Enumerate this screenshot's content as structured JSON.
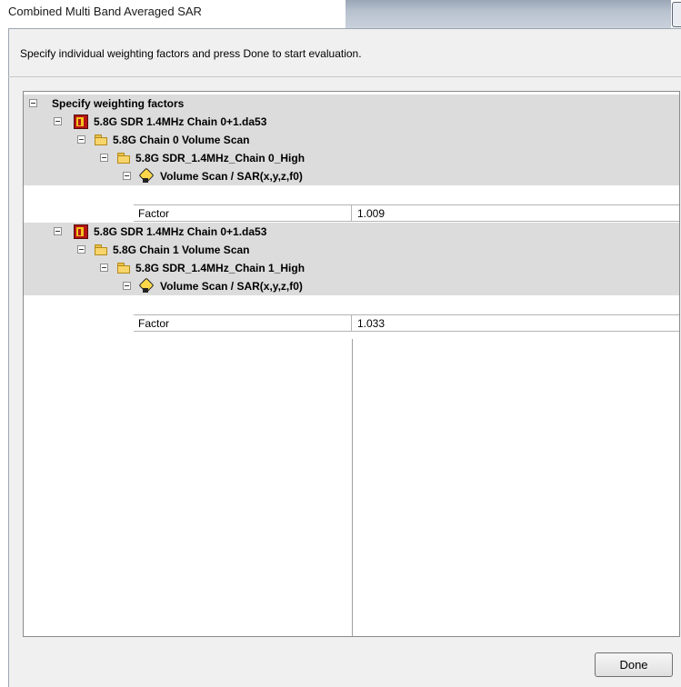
{
  "window": {
    "title": "Combined Multi Band Averaged SAR"
  },
  "instruction": "Specify individual weighting factors and press Done to start evaluation.",
  "tree": {
    "root_label": "Specify weighting factors",
    "files": [
      {
        "label": "5.8G SDR 1.4MHz Chain 0+1.da53",
        "folder": "5.8G Chain 0 Volume Scan",
        "subfolder": "5.8G SDR_1.4MHz_Chain 0_High",
        "measurement": "Volume Scan / SAR(x,y,z,f0)",
        "factor_label": "Factor",
        "factor_value": "1.009"
      },
      {
        "label": "5.8G SDR 1.4MHz Chain 0+1.da53",
        "folder": "5.8G Chain 1 Volume Scan",
        "subfolder": "5.8G SDR_1.4MHz_Chain 1_High",
        "measurement": "Volume Scan / SAR(x,y,z,f0)",
        "factor_label": "Factor",
        "factor_value": "1.033"
      }
    ]
  },
  "buttons": {
    "done": "Done"
  },
  "icons": {
    "toggle": "minus-box-icon",
    "file": "data-file-icon",
    "folder": "folder-icon",
    "measurement": "volume-scan-icon"
  }
}
